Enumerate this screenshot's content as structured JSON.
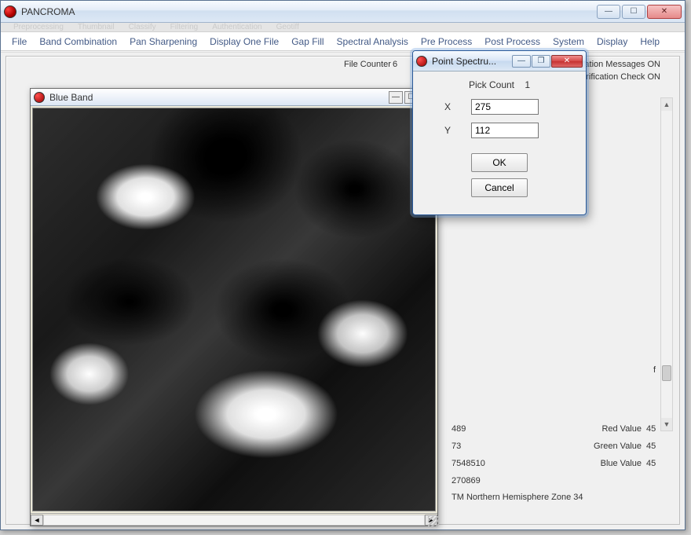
{
  "app": {
    "title": "PANCROMA"
  },
  "ghost_bar": [
    "Preprocessing",
    "Thumbnail",
    "Classify",
    "Filtering",
    "Authentication",
    "Geotiff"
  ],
  "menu": [
    "File",
    "Band Combination",
    "Pan Sharpening",
    "Display One File",
    "Gap Fill",
    "Spectral Analysis",
    "Pre Process",
    "Post Process",
    "System",
    "Display",
    "Help"
  ],
  "status": {
    "file_counter_label": "File Counter",
    "file_counter_value": "6",
    "info_messages": "Information Messages  ON",
    "file_size_check": "File Size Verification Check   ON",
    "stray_f": "f"
  },
  "child": {
    "title": "Blue Band"
  },
  "dialog": {
    "title": "Point Spectru...",
    "pick_label": "Pick Count",
    "pick_value": "1",
    "x_label": "X",
    "x_value": "275",
    "y_label": "Y",
    "y_value": "112",
    "ok_label": "OK",
    "cancel_label": "Cancel"
  },
  "info_panel": {
    "rows": [
      {
        "lval": "489",
        "rlab": "Red Value",
        "rval": "45"
      },
      {
        "lval": "73",
        "rlab": "Green Value",
        "rval": "45"
      },
      {
        "lval": "7548510",
        "rlab": "Blue Value",
        "rval": "45"
      },
      {
        "lval": "270869",
        "rlab": "",
        "rval": ""
      }
    ],
    "zone": "TM Northern Hemisphere Zone 34"
  },
  "glyphs": {
    "min": "—",
    "max": "☐",
    "close": "✕",
    "left": "◄",
    "right": "►",
    "up": "▲",
    "down": "▼",
    "restore": "❐"
  }
}
